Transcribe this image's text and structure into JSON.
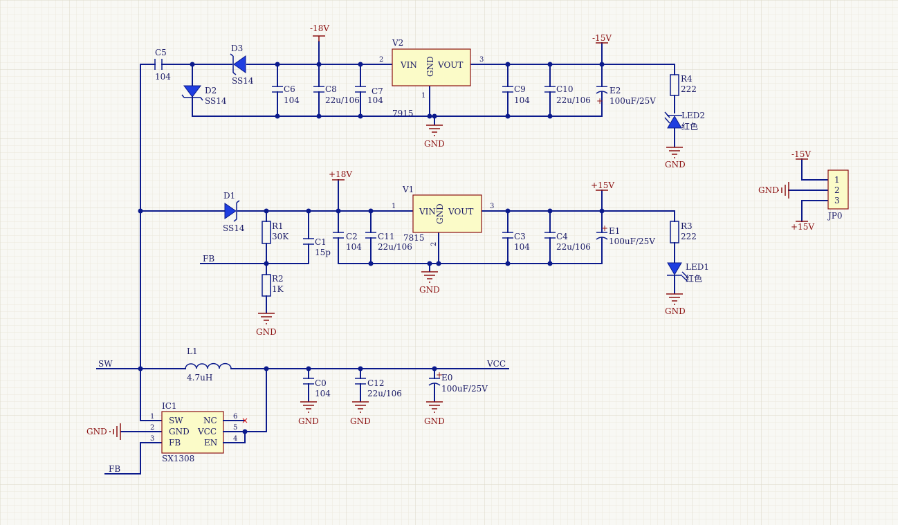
{
  "components": {
    "V2": {
      "ref": "V2",
      "value": "7915",
      "pins": {
        "vin": "VIN",
        "gnd": "GND",
        "vout": "VOUT",
        "p1": "1",
        "p2": "2",
        "p3": "3"
      }
    },
    "V1": {
      "ref": "V1",
      "value": "7815",
      "pins": {
        "vin": "VIN",
        "gnd": "GND",
        "vout": "VOUT",
        "p1": "1",
        "p2": "2",
        "p3": "3"
      }
    },
    "IC1": {
      "ref": "IC1",
      "value": "SX1308",
      "pins": {
        "sw": "SW",
        "gnd": "GND",
        "fb": "FB",
        "nc": "NC",
        "vcc": "VCC",
        "en": "EN",
        "p1": "1",
        "p2": "2",
        "p3": "3",
        "p4": "4",
        "p5": "5",
        "p6": "6"
      }
    },
    "JP0": {
      "ref": "JP0",
      "pins": {
        "p1": "1",
        "p2": "2",
        "p3": "3"
      }
    },
    "C5": {
      "ref": "C5",
      "value": "104"
    },
    "D3": {
      "ref": "D3",
      "value": "SS14"
    },
    "D2": {
      "ref": "D2",
      "value": "SS14"
    },
    "D1": {
      "ref": "D1",
      "value": "SS14"
    },
    "C6": {
      "ref": "C6",
      "value": "104"
    },
    "C8": {
      "ref": "C8",
      "value": "22u/106"
    },
    "C7": {
      "ref": "C7",
      "value": "104"
    },
    "C9": {
      "ref": "C9",
      "value": "104"
    },
    "C10": {
      "ref": "C10",
      "value": "22u/106"
    },
    "E2": {
      "ref": "E2",
      "value": "100uF/25V"
    },
    "R4": {
      "ref": "R4",
      "value": "222"
    },
    "LED2": {
      "ref": "LED2",
      "value": "红色"
    },
    "R1": {
      "ref": "R1",
      "value": "30K"
    },
    "C1": {
      "ref": "C1",
      "value": "15p"
    },
    "R2": {
      "ref": "R2",
      "value": "1K"
    },
    "C2": {
      "ref": "C2",
      "value": "104"
    },
    "C11": {
      "ref": "C11",
      "value": "22u/106"
    },
    "C3": {
      "ref": "C3",
      "value": "104"
    },
    "C4": {
      "ref": "C4",
      "value": "22u/106"
    },
    "E1": {
      "ref": "E1",
      "value": "100uF/25V"
    },
    "R3": {
      "ref": "R3",
      "value": "222"
    },
    "LED1": {
      "ref": "LED1",
      "value": "红色"
    },
    "L1": {
      "ref": "L1",
      "value": "4.7uH"
    },
    "C0": {
      "ref": "C0",
      "value": "104"
    },
    "C12": {
      "ref": "C12",
      "value": "22u/106"
    },
    "E0": {
      "ref": "E0",
      "value": "100uF/25V"
    }
  },
  "power": {
    "neg18": "-18V",
    "pos18": "+18V",
    "neg15": "-15V",
    "pos15": "+15V",
    "gnd": "GND"
  },
  "nets": {
    "sw": "SW",
    "fb": "FB",
    "vcc": "VCC"
  },
  "polarity": {
    "plus": "+"
  }
}
